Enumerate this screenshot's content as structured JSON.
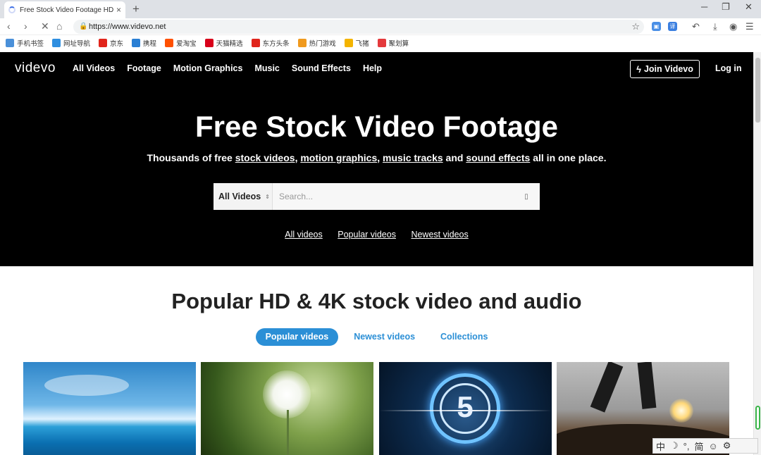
{
  "browser": {
    "tab_title": "Free Stock Video Footage HD",
    "tab_close": "×",
    "new_tab": "+",
    "url": "https://www.videvo.net",
    "window_controls": [
      "─",
      "❐",
      "✕"
    ],
    "bookmarks": [
      {
        "label": "手机书签",
        "icon": "phone-icon",
        "color": "#4a90d9"
      },
      {
        "label": "网址导航",
        "icon": "nav-icon",
        "color": "#2f8fe0"
      },
      {
        "label": "京东",
        "icon": "jd-icon",
        "color": "#e1251b"
      },
      {
        "label": "携程",
        "icon": "ctrip-icon",
        "color": "#2a7fd4"
      },
      {
        "label": "爱淘宝",
        "icon": "taobao-icon",
        "color": "#ff5000"
      },
      {
        "label": "天猫精选",
        "icon": "tmall-icon",
        "color": "#d8001a"
      },
      {
        "label": "东方头条",
        "icon": "toutiao-icon",
        "color": "#e0251c"
      },
      {
        "label": "热门游戏",
        "icon": "game-icon",
        "color": "#f09a1e"
      },
      {
        "label": "飞猪",
        "icon": "fliggy-icon",
        "color": "#f4b400"
      },
      {
        "label": "聚划算",
        "icon": "juhuasuan-icon",
        "color": "#e4393c"
      }
    ]
  },
  "site": {
    "logo": "videvo",
    "nav": [
      "All Videos",
      "Footage",
      "Motion Graphics",
      "Music",
      "Sound Effects",
      "Help"
    ],
    "join_label": "Join Videvo",
    "login_label": "Log in"
  },
  "hero": {
    "title": "Free Stock Video Footage",
    "tagline_prefix": "Thousands of free ",
    "tagline_links": [
      "stock videos",
      "motion graphics",
      "music tracks",
      "sound effects"
    ],
    "tagline_sep1": ", ",
    "tagline_sep2": ", ",
    "tagline_and": " and ",
    "tagline_suffix": " all in one place.",
    "search_category": "All Videos",
    "search_placeholder": "Search...",
    "quick_links": [
      "All videos",
      "Popular videos",
      "Newest videos"
    ]
  },
  "popular": {
    "title": "Popular HD & 4K stock video and audio",
    "tabs": [
      "Popular videos",
      "Newest videos",
      "Collections"
    ],
    "active_tab": "Popular videos",
    "thumb_number": "5"
  },
  "ime": [
    "中",
    "☽",
    "°,",
    "简",
    "☺",
    "⚙"
  ],
  "colors": {
    "accent": "#2b8fd6",
    "hero_bg": "#000000"
  }
}
